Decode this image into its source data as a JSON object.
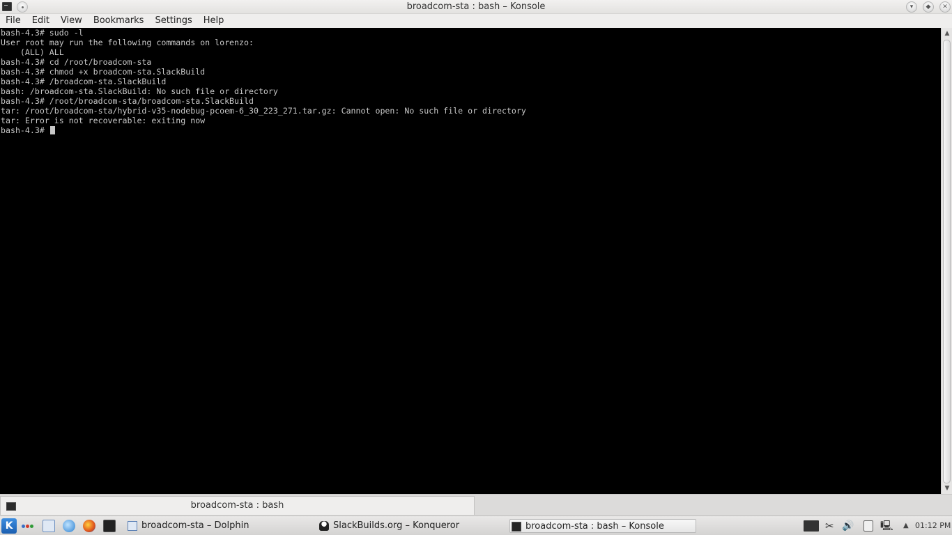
{
  "window": {
    "title": "broadcom-sta : bash – Konsole"
  },
  "menu": {
    "items": [
      "File",
      "Edit",
      "View",
      "Bookmarks",
      "Settings",
      "Help"
    ]
  },
  "terminal": {
    "lines": [
      "bash-4.3# sudo -l",
      "User root may run the following commands on lorenzo:",
      "    (ALL) ALL",
      "bash-4.3# cd /root/broadcom-sta",
      "bash-4.3# chmod +x broadcom-sta.SlackBuild",
      "bash-4.3# /broadcom-sta.SlackBuild",
      "bash: /broadcom-sta.SlackBuild: No such file or directory",
      "bash-4.3# /root/broadcom-sta/broadcom-sta.SlackBuild",
      "tar: /root/broadcom-sta/hybrid-v35-nodebug-pcoem-6_30_223_271.tar.gz: Cannot open: No such file or directory",
      "tar: Error is not recoverable: exiting now"
    ],
    "prompt": "bash-4.3# "
  },
  "tab": {
    "label": "broadcom-sta : bash"
  },
  "taskbar": {
    "tasks": [
      "broadcom-sta – Dolphin",
      "SlackBuilds.org – Konqueror",
      "broadcom-sta : bash – Konsole"
    ],
    "clock": "01:12 PM"
  },
  "colors": {
    "terminal_bg": "#000000",
    "terminal_fg": "#c8c8c8"
  }
}
